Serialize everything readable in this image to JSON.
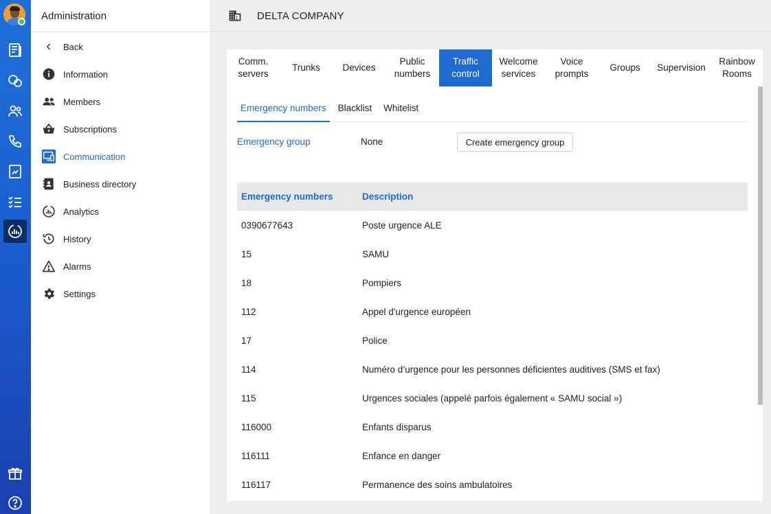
{
  "sidebar": {
    "title": "Administration",
    "items": [
      {
        "label": "Back",
        "icon": "chevron-left-icon"
      },
      {
        "label": "Information",
        "icon": "info-icon"
      },
      {
        "label": "Members",
        "icon": "members-icon"
      },
      {
        "label": "Subscriptions",
        "icon": "basket-icon"
      },
      {
        "label": "Communication",
        "icon": "communication-icon",
        "active": true
      },
      {
        "label": "Business directory",
        "icon": "directory-icon"
      },
      {
        "label": "Analytics",
        "icon": "analytics-icon"
      },
      {
        "label": "History",
        "icon": "history-icon"
      },
      {
        "label": "Alarms",
        "icon": "alarm-icon"
      },
      {
        "label": "Settings",
        "icon": "gear-icon"
      }
    ]
  },
  "header": {
    "company": "DELTA COMPANY",
    "icon": "building-icon"
  },
  "tabs": [
    {
      "label": "Comm.\nservers"
    },
    {
      "label": "Trunks"
    },
    {
      "label": "Devices"
    },
    {
      "label": "Public\nnumbers"
    },
    {
      "label": "Traffic\ncontrol",
      "active": true
    },
    {
      "label": "Welcome\nservices"
    },
    {
      "label": "Voice\nprompts"
    },
    {
      "label": "Groups"
    },
    {
      "label": "Supervision"
    },
    {
      "label": "Rainbow\nRooms"
    }
  ],
  "subtabs": [
    {
      "label": "Emergency numbers",
      "active": true
    },
    {
      "label": "Blacklist"
    },
    {
      "label": "Whitelist"
    }
  ],
  "emergency_group": {
    "label": "Emergency group",
    "value": "None",
    "button": "Create emergency group"
  },
  "table": {
    "headers": [
      "Emergency numbers",
      "Description"
    ],
    "rows": [
      [
        "0390677643",
        "Poste urgence ALE"
      ],
      [
        "15",
        "SAMU"
      ],
      [
        "18",
        "Pompiers"
      ],
      [
        "112",
        "Appel d'urgence européen"
      ],
      [
        "17",
        "Police"
      ],
      [
        "114",
        "Numéro d’urgence pour les personnes déficientes auditives (SMS et fax)"
      ],
      [
        "115",
        "Urgences sociales (appelé parfois également « SAMU social »)"
      ],
      [
        "116000",
        "Enfants disparus"
      ],
      [
        "116111",
        "Enfance en danger"
      ],
      [
        "116117",
        "Permanence des soins ambulatoires"
      ]
    ]
  },
  "colors": {
    "accent": "#1d6bd0",
    "rail": "#1a5fd0",
    "rail_active": "#0c2c66"
  }
}
